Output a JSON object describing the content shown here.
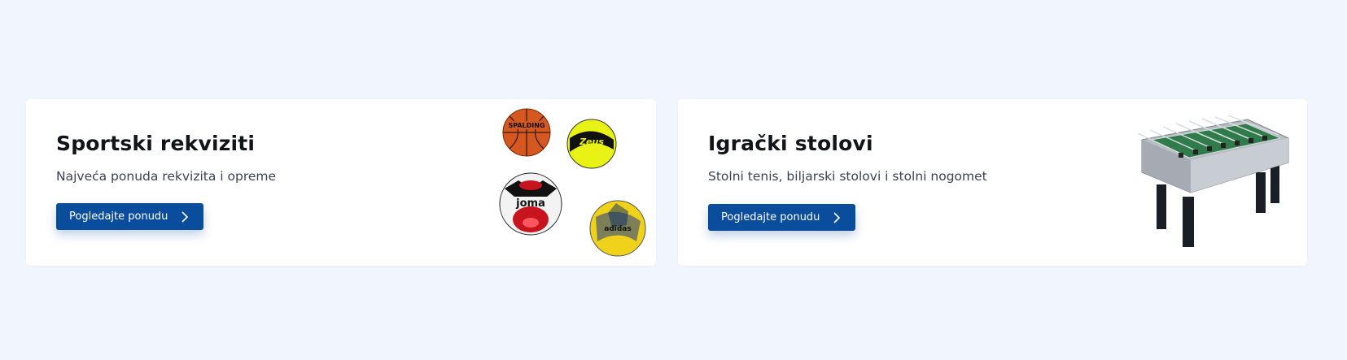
{
  "cards": [
    {
      "title": "Sportski rekviziti",
      "subtitle": "Najveća ponuda rekvizita i opreme",
      "button": "Pogledajte ponudu",
      "image_label": "sports-balls-image",
      "ball_brands": [
        "SPALDING",
        "Zeus",
        "joma",
        "adidas"
      ]
    },
    {
      "title": "Igrački stolovi",
      "subtitle": "Stolni tenis, biljarski stolovi i stolni nogomet",
      "button": "Pogledajte ponudu",
      "image_label": "foosball-table-image"
    }
  ],
  "colors": {
    "page_bg": "#f1f5fd",
    "card_bg": "#ffffff",
    "button_bg": "#0a4d9c",
    "button_text": "#ffffff",
    "title": "#111418",
    "subtitle": "#3b4150"
  },
  "icons": {
    "button_arrow": "chevron-right-icon"
  }
}
